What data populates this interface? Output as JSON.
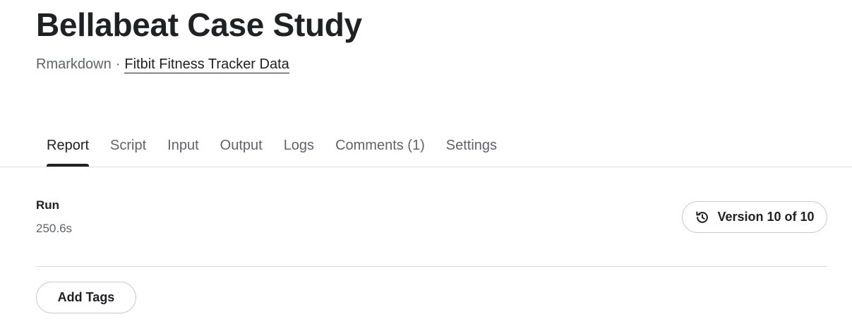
{
  "header": {
    "title": "Bellabeat Case Study",
    "language": "Rmarkdown",
    "separator": "·",
    "dataset_link": "Fitbit Fitness Tracker Data"
  },
  "tabs": [
    {
      "label": "Report",
      "active": true
    },
    {
      "label": "Script",
      "active": false
    },
    {
      "label": "Input",
      "active": false
    },
    {
      "label": "Output",
      "active": false
    },
    {
      "label": "Logs",
      "active": false
    },
    {
      "label": "Comments (1)",
      "active": false
    },
    {
      "label": "Settings",
      "active": false
    }
  ],
  "run": {
    "label": "Run",
    "time": "250.6s"
  },
  "version": {
    "icon": "history-icon",
    "label": "Version 10 of 10"
  },
  "tags": {
    "button_label": "Add Tags"
  }
}
